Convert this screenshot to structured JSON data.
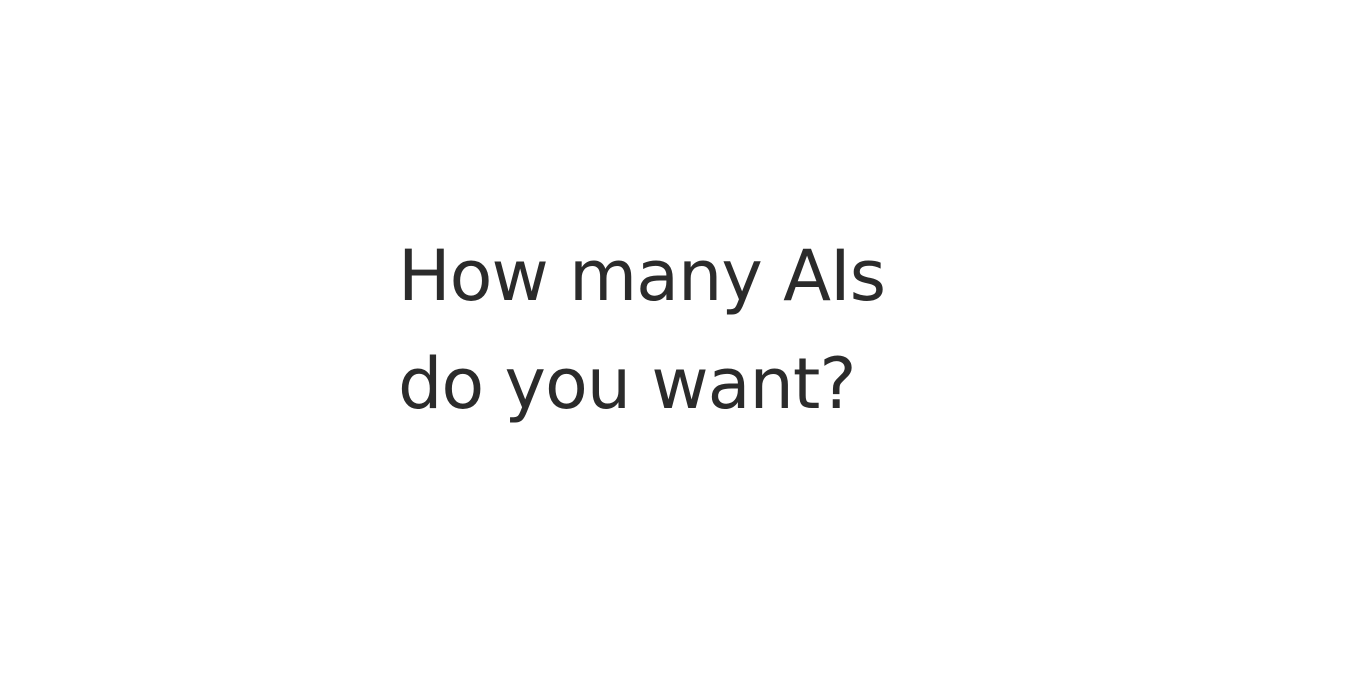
{
  "screen": {
    "question_line_1": "How many AIs",
    "question_line_2": "do you want?"
  },
  "colors": {
    "background": "#ffffff",
    "text": "#2b2b2b"
  }
}
